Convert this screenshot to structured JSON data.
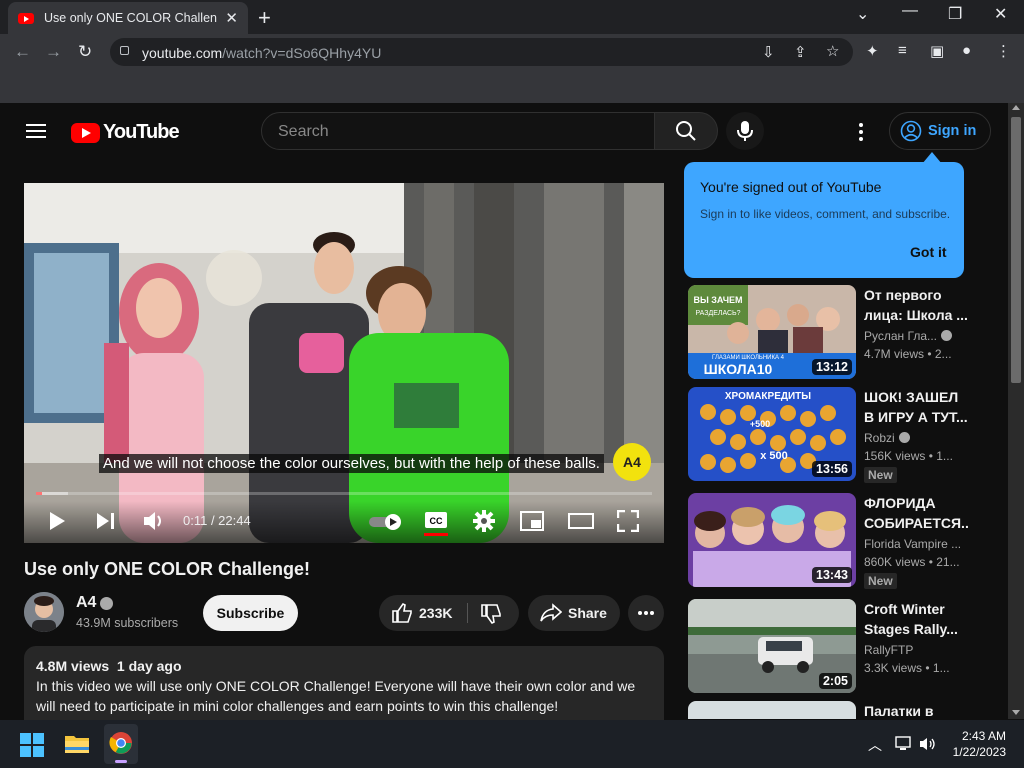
{
  "browser": {
    "tab_title": "Use only ONE COLOR Challenge! - YouTube",
    "url_host": "youtube.com",
    "url_path": "/watch?v=dSo6QHhy4YU"
  },
  "yt": {
    "logo_text": "YouTube",
    "search_placeholder": "Search",
    "sign_in": "Sign in"
  },
  "popup": {
    "heading": "You're signed out of YouTube",
    "sub": "Sign in to like videos, comment, and subscribe.",
    "got_it": "Got it"
  },
  "player": {
    "caption": "And we will not choose the color ourselves, but with the help of these balls.",
    "watermark": "A4",
    "time": "0:11 / 22:44",
    "progress_fraction": 0.008
  },
  "video": {
    "title": "Use only ONE COLOR Challenge!",
    "channel": "A4",
    "subscribers": "43.9M subscribers",
    "subscribe": "Subscribe",
    "likes": "233K",
    "share": "Share",
    "views_date": "4.8M views  1 day ago",
    "description": "In this video we will use only ONE COLOR Challenge! Everyone will have their own color and we will need to participate in mini color challenges and earn points to win this challenge!"
  },
  "related": [
    {
      "title_1": "От первого",
      "title_2": "лица: Школа ...",
      "channel": "Руслан Гла...",
      "views": "4.7M views • 2...",
      "duration": "13:12",
      "thumb_text_1": "ВЫ ЗАЧЕМ",
      "thumb_text_2": "РАЗДЕЛАСЬ?",
      "thumb_text_3": "ГЛАЗАМИ ШКОЛЬНИКА 4",
      "thumb_text_4": "ШКОЛА10",
      "new": ""
    },
    {
      "title_1": "ШОК! ЗАШЕЛ",
      "title_2": "В ИГРУ А ТУТ...",
      "channel": "Robzi",
      "views": "156K views • 1...",
      "duration": "13:56",
      "thumb_text_1": "ХРОМАКРЕДИТЫ",
      "thumb_text_2": "+500",
      "thumb_text_3": "x 500",
      "new": "New"
    },
    {
      "title_1": "ФЛОРИДА",
      "title_2": "СОБИРАЕТСЯ...",
      "channel": "Florida Vampire ...",
      "views": "860K views • 21...",
      "duration": "13:43",
      "new": "New"
    },
    {
      "title_1": "Croft Winter",
      "title_2": "Stages Rally...",
      "channel": "RallyFTP",
      "views": "3.3K views • 1...",
      "duration": "2:05",
      "new": ""
    },
    {
      "title_1": "Палатки в",
      "title_2": ""
    }
  ],
  "taskbar": {
    "time": "2:43 AM",
    "date": "1/22/2023"
  },
  "colors": {
    "brand_red": "#ff0000",
    "accent_blue": "#3ea6ff",
    "page_bg": "#0f0f0f"
  }
}
